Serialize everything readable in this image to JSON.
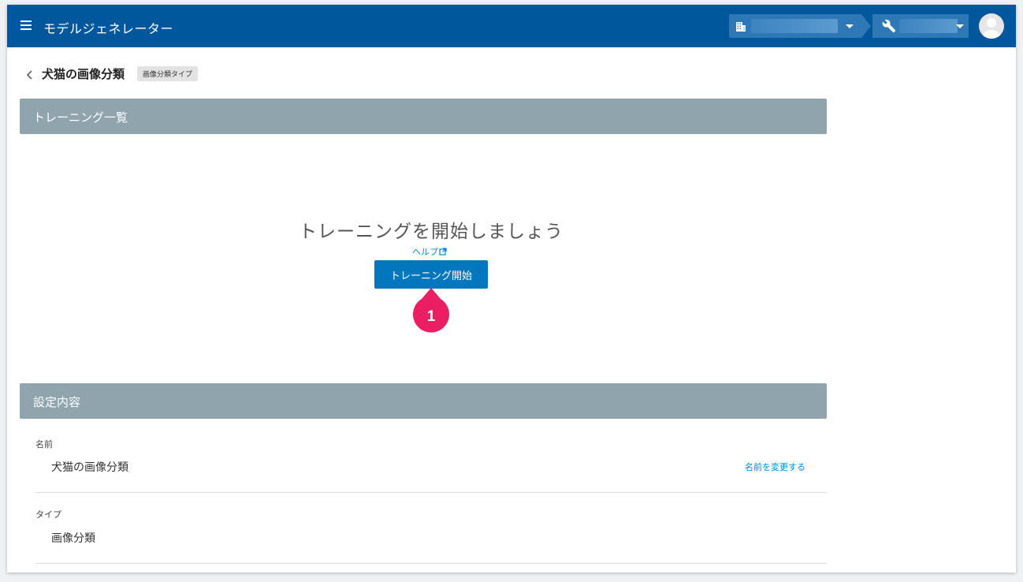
{
  "header": {
    "app_title": "モデルジェネレーター",
    "org_selector_value": "",
    "project_selector_value": "",
    "menu_icon": "hamburger-menu-icon",
    "org_icon": "building-icon",
    "project_icon": "wrench-icon",
    "avatar_icon": "user-avatar-icon"
  },
  "page": {
    "title": "犬猫の画像分類",
    "type_tag": "画像分類タイプ"
  },
  "training": {
    "section_title": "トレーニング一覧",
    "empty_message": "トレーニングを開始しましょう",
    "help_link": "ヘルプ",
    "start_button": "トレーニング開始",
    "step_marker": "1"
  },
  "settings": {
    "section_title": "設定内容",
    "fields": [
      {
        "label": "名前",
        "value": "犬猫の画像分類",
        "action": "名前を変更する"
      },
      {
        "label": "タイプ",
        "value": "画像分類"
      }
    ]
  },
  "colors": {
    "topbar": "#01579b",
    "section_header": "#90a4ae",
    "primary_button": "#0277bd",
    "link": "#0288d1",
    "marker": "#e91e63"
  }
}
